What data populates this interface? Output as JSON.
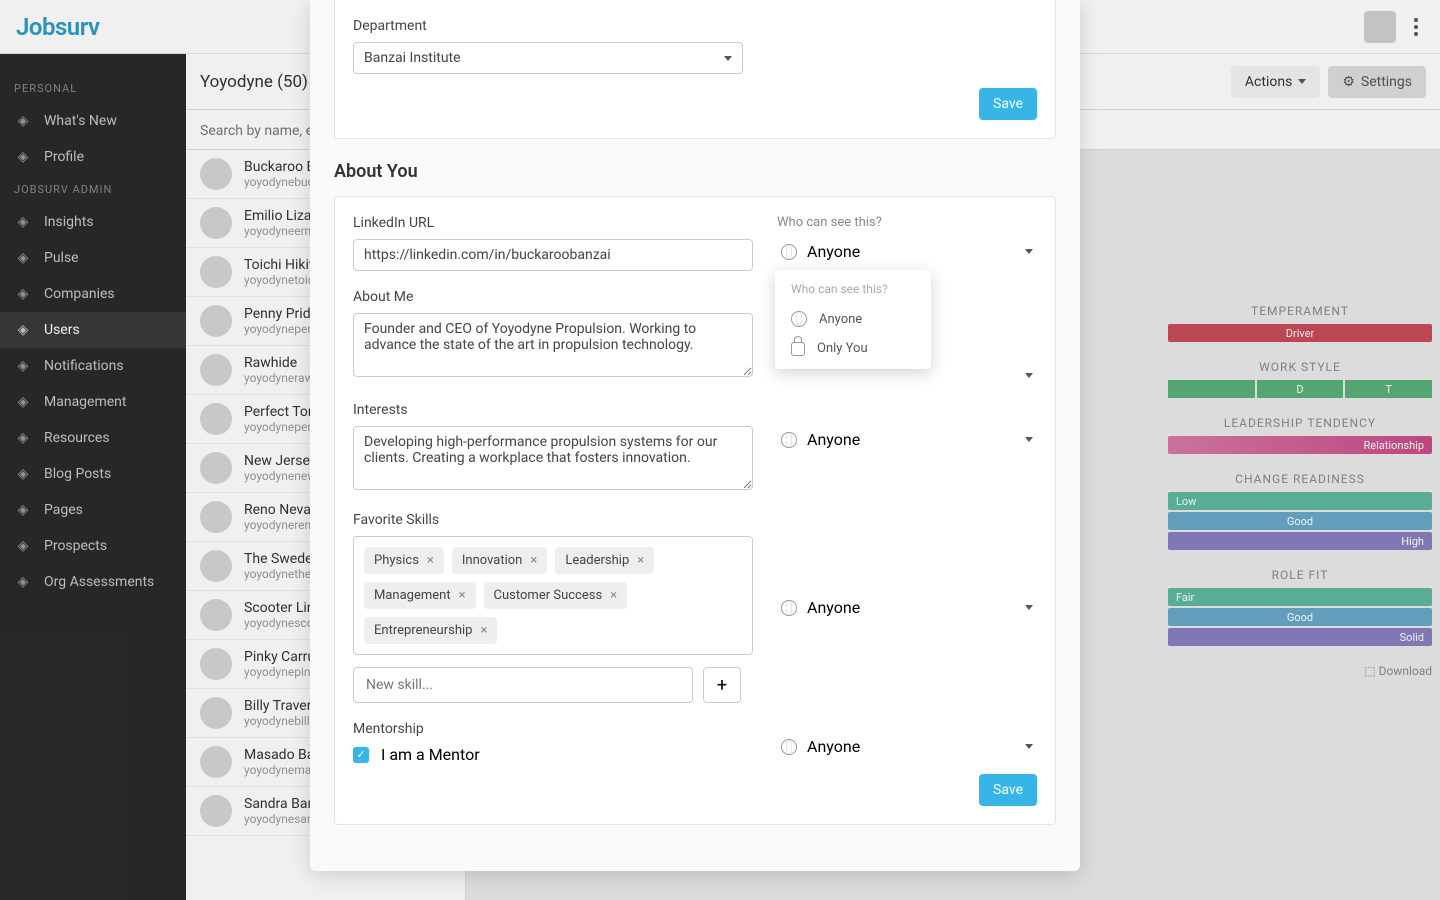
{
  "brand": "Jobsurv",
  "sidebar": {
    "sections": [
      {
        "title": "PERSONAL",
        "items": [
          {
            "label": "What's New",
            "name": "sidebar-item-whats-new"
          },
          {
            "label": "Profile",
            "name": "sidebar-item-profile"
          }
        ]
      },
      {
        "title": "JOBSURV ADMIN",
        "items": [
          {
            "label": "Insights",
            "name": "sidebar-item-insights"
          },
          {
            "label": "Pulse",
            "name": "sidebar-item-pulse"
          },
          {
            "label": "Companies",
            "name": "sidebar-item-companies"
          },
          {
            "label": "Users",
            "name": "sidebar-item-users",
            "active": true
          },
          {
            "label": "Notifications",
            "name": "sidebar-item-notifications"
          },
          {
            "label": "Management",
            "name": "sidebar-item-management"
          },
          {
            "label": "Resources",
            "name": "sidebar-item-resources"
          },
          {
            "label": "Blog Posts",
            "name": "sidebar-item-blog-posts"
          },
          {
            "label": "Pages",
            "name": "sidebar-item-pages"
          },
          {
            "label": "Prospects",
            "name": "sidebar-item-prospects"
          },
          {
            "label": "Org Assessments",
            "name": "sidebar-item-org-assessments"
          }
        ]
      }
    ]
  },
  "contentHeader": {
    "companyLabel": "Yoyodyne (50)",
    "actions": "Actions",
    "settings": "Settings"
  },
  "search": {
    "placeholder": "Search by name, en"
  },
  "userList": [
    {
      "name": "Buckaroo B",
      "email": "yoyodynebuck"
    },
    {
      "name": "Emilio Lizar",
      "email": "yoyodyneemili"
    },
    {
      "name": "Toichi Hikit",
      "email": "yoyodynetoich"
    },
    {
      "name": "Penny Prid",
      "email": "yoyodynepenn"
    },
    {
      "name": "Rawhide",
      "email": "yoyodynerawh"
    },
    {
      "name": "Perfect Tom",
      "email": "yoyodyneperfe"
    },
    {
      "name": "New Jersey",
      "email": "yoyodynenewj"
    },
    {
      "name": "Reno Neva",
      "email": "yoyodynereno"
    },
    {
      "name": "The Swede",
      "email": "yoyodynethesv"
    },
    {
      "name": "Scooter Lin",
      "email": "yoyodynescoot"
    },
    {
      "name": "Pinky Carru",
      "email": "yoyodynepinky"
    },
    {
      "name": "Billy Traver",
      "email": "yoyodynebilly@"
    },
    {
      "name": "Masado Ba",
      "email": "yoyodynemasa"
    },
    {
      "name": "Sandra Ban",
      "email": "yoyodynesandra@gmail.com"
    }
  ],
  "traits": {
    "temperament": {
      "label": "TEMPERAMENT",
      "value": "Driver"
    },
    "workStyle": {
      "label": "WORK STYLE",
      "segments": [
        "",
        "D",
        "T"
      ]
    },
    "leadership": {
      "label": "LEADERSHIP TENDENCY",
      "value": "Relationship"
    },
    "changeReadiness": {
      "label": "CHANGE READINESS",
      "rows": [
        "Low",
        "Good",
        "High"
      ]
    },
    "roleFit": {
      "label": "ROLE FIT",
      "rows": [
        "Fair",
        "Good",
        "Solid"
      ]
    },
    "download": "Download"
  },
  "modal": {
    "departmentLabel": "Department",
    "departmentValue": "Banzai Institute",
    "save": "Save",
    "aboutYouTitle": "About You",
    "linkedinLabel": "LinkedIn URL",
    "linkedinValue": "https://linkedin.com/in/buckaroobanzai",
    "aboutMeLabel": "About Me",
    "aboutMeValue": "Founder and CEO of Yoyodyne Propulsion. Working to advance the state of the art in propulsion technology.",
    "interestsLabel": "Interests",
    "interestsValue": "Developing high-performance propulsion systems for our clients. Creating a workplace that fosters innovation.",
    "skillsLabel": "Favorite Skills",
    "skills": [
      "Physics",
      "Innovation",
      "Leadership",
      "Management",
      "Customer Success",
      "Entrepreneurship"
    ],
    "newSkillPlaceholder": "New skill...",
    "mentorshipLabel": "Mentorship",
    "mentorCheckbox": "I am a Mentor",
    "visibility": {
      "label": "Who can see this?",
      "anyone": "Anyone",
      "onlyYou": "Only You"
    }
  }
}
